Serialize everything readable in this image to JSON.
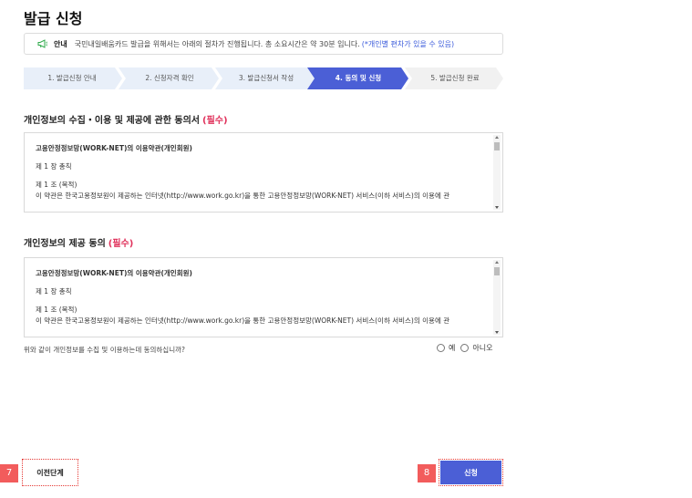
{
  "page": {
    "title": "발급 신청"
  },
  "notice": {
    "label": "안내",
    "text": "국민내일배움카드 발급을 위해서는 아래의 절차가 진행됩니다. 총 소요시간은 약 30분 입니다.",
    "highlight": "(*개인별 편차가 있을 수 있음)"
  },
  "steps": [
    {
      "label": "1. 발급신청 안내",
      "state": "done"
    },
    {
      "label": "2. 신청자격 확인",
      "state": "done"
    },
    {
      "label": "3. 발급신청서 작성",
      "state": "done"
    },
    {
      "label": "4. 동의 및 신청",
      "state": "active"
    },
    {
      "label": "5. 발급신청 완료",
      "state": "todo"
    }
  ],
  "colors": {
    "active_step": "#4b5fd6",
    "done_step": "#e8eff9",
    "todo_step": "#f1f1f1",
    "required": "#e0315b",
    "submit": "#4b5fd6",
    "badge": "#f25c5c"
  },
  "section1": {
    "title": "개인정보의 수집・이용 및 제공에 관한 동의서",
    "required": "(필수)",
    "terms_title": "고용안정정보망(WORK-NET)의 이용약관(개인회원)",
    "line1": "제 1 장 총칙",
    "line2": "제 1 조 (목적)",
    "line3": "이 약관은 한국고용정보원이 제공하는 인터넷(http://www.work.go.kr)을 통한 고용안정정보망(WORK-NET) 서비스(이하 서비스)의 이용에 관"
  },
  "section2": {
    "title": "개인정보의 제공 동의",
    "required": "(필수)",
    "terms_title": "고용안정정보망(WORK-NET)의 이용약관(개인회원)",
    "line1": "제 1 장 총칙",
    "line2": "제 1 조 (목적)",
    "line3": "이 약관은 한국고용정보원이 제공하는 인터넷(http://www.work.go.kr)을 통한 고용안정정보망(WORK-NET) 서비스(이하 서비스)의 이용에 관"
  },
  "consent": {
    "question": "위와 같이 개인정보를 수집 및 이용하는데 동의하십니까?",
    "yes": "예",
    "no": "아니오"
  },
  "buttons": {
    "prev": "이전단계",
    "submit": "신청",
    "prev_badge": "7",
    "submit_badge": "8"
  },
  "icons": {
    "notice": "megaphone-icon"
  }
}
